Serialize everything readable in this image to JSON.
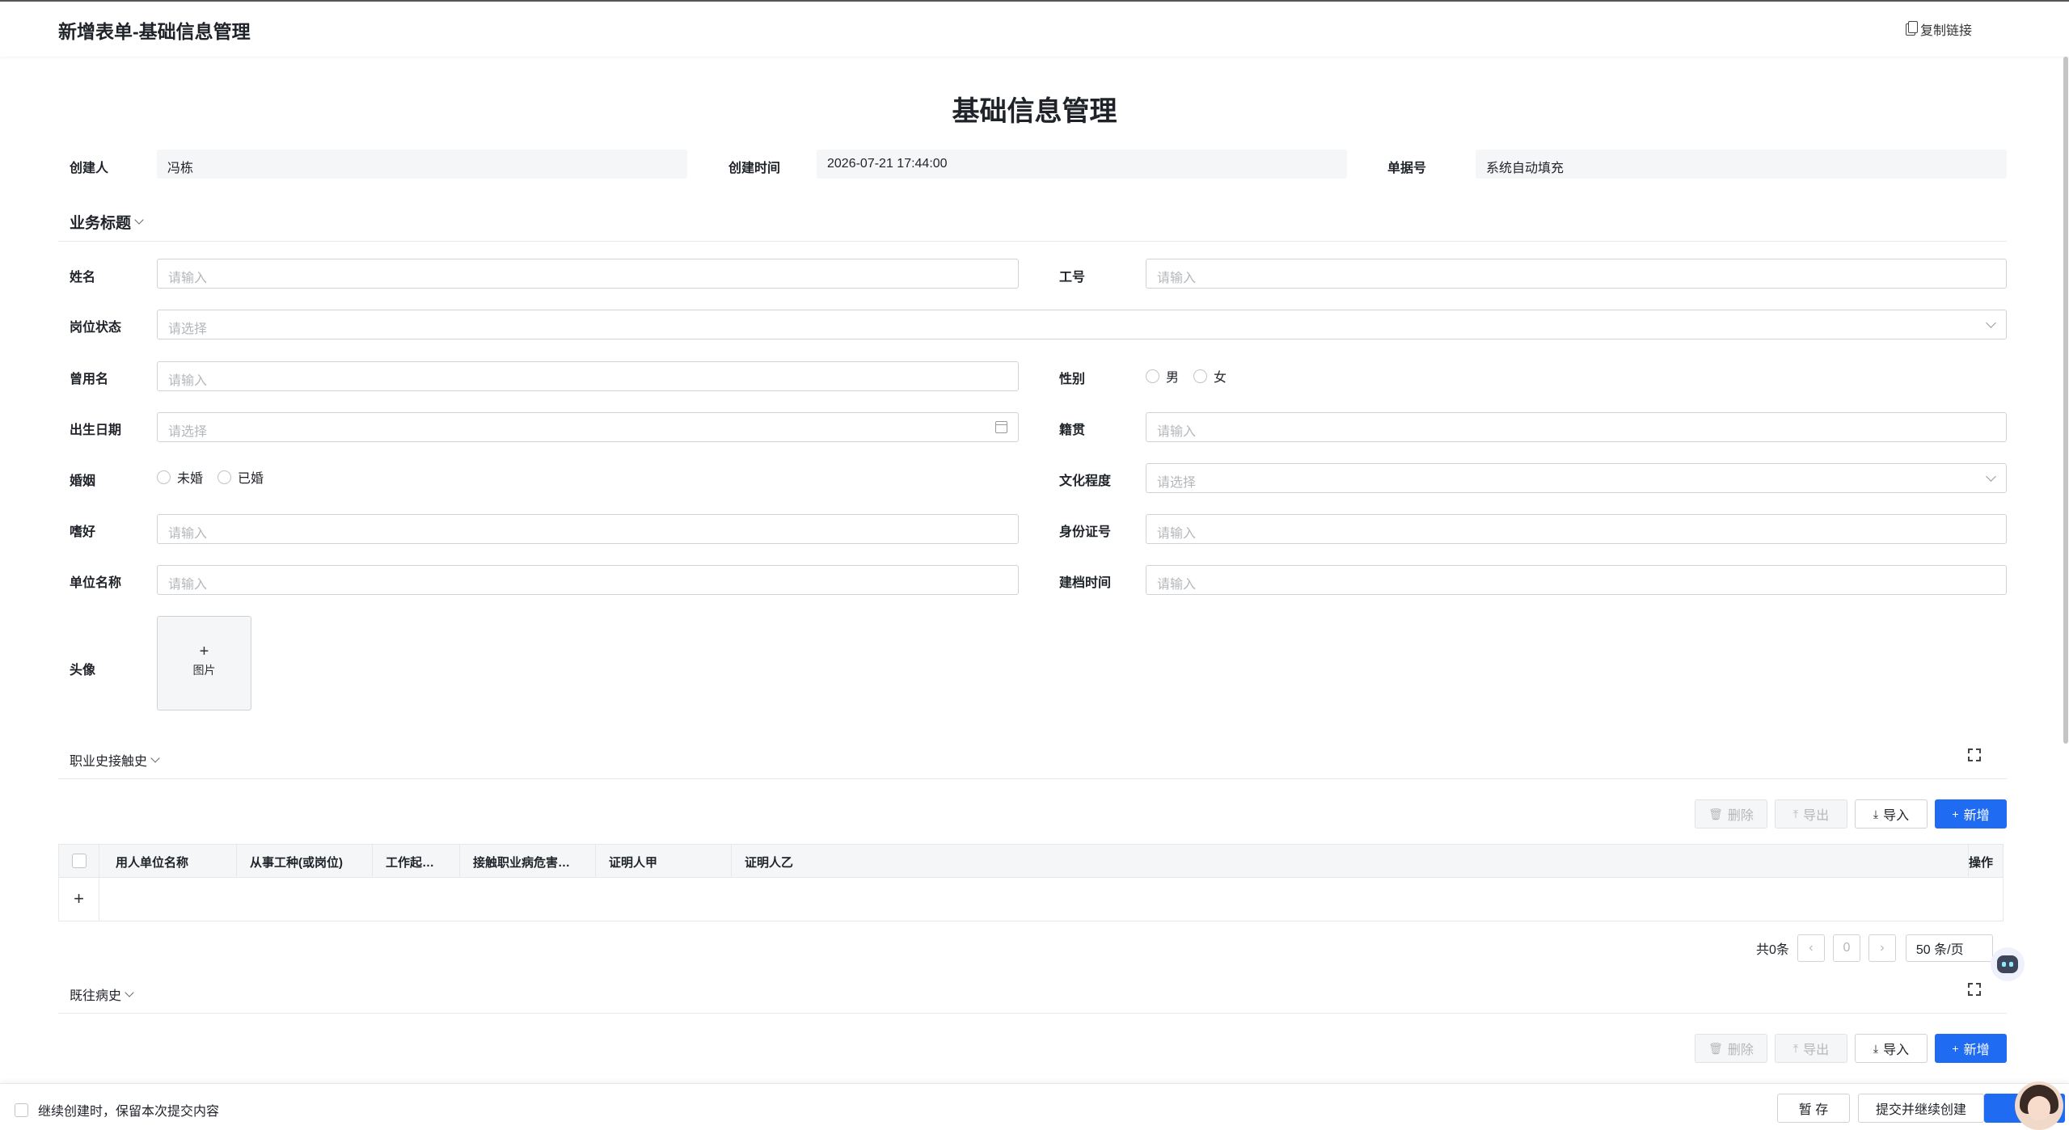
{
  "header": {
    "title": "新增表单-基础信息管理",
    "copy_link": "复制链接"
  },
  "form": {
    "title": "基础信息管理",
    "meta": {
      "creator_label": "创建人",
      "creator_value": "冯栋",
      "created_time_label": "创建时间",
      "created_time_value": "2026-07-21 17:44:00",
      "doc_no_label": "单据号",
      "doc_no_value": "系统自动填充"
    },
    "section_business": "业务标题",
    "fields": {
      "name": {
        "label": "姓名",
        "placeholder": "请输入"
      },
      "job_no": {
        "label": "工号",
        "placeholder": "请输入"
      },
      "post_status": {
        "label": "岗位状态",
        "placeholder": "请选择"
      },
      "former_name": {
        "label": "曾用名",
        "placeholder": "请输入"
      },
      "gender": {
        "label": "性别",
        "options": [
          "男",
          "女"
        ]
      },
      "birthday": {
        "label": "出生日期",
        "placeholder": "请选择"
      },
      "native_place": {
        "label": "籍贯",
        "placeholder": "请输入"
      },
      "marriage": {
        "label": "婚姻",
        "options": [
          "未婚",
          "已婚"
        ]
      },
      "education": {
        "label": "文化程度",
        "placeholder": "请选择"
      },
      "hobby": {
        "label": "嗜好",
        "placeholder": "请输入"
      },
      "id_no": {
        "label": "身份证号",
        "placeholder": "请输入"
      },
      "company": {
        "label": "单位名称",
        "placeholder": "请输入"
      },
      "archive_time": {
        "label": "建档时间",
        "placeholder": "请输入"
      },
      "avatar": {
        "label": "头像",
        "upload_text": "图片",
        "upload_plus": "+"
      }
    }
  },
  "table_actions": {
    "delete": "删除",
    "export": "导出",
    "import": "导入",
    "add": "新增"
  },
  "occupation_history": {
    "title": "职业史接触史",
    "columns": [
      "用人单位名称",
      "从事工种(或岗位)",
      "工作起…",
      "接触职业病危害…",
      "证明人甲",
      "证明人乙",
      "操作"
    ],
    "add_row": "+",
    "pager": {
      "total": "共0条",
      "page": "0",
      "page_size": "50 条/页"
    }
  },
  "medical_history": {
    "title": "既往病史"
  },
  "footer": {
    "keep_text": "继续创建时，保留本次提交内容",
    "save_draft": "暂 存",
    "submit_continue": "提交并继续创建",
    "submit": "提"
  }
}
